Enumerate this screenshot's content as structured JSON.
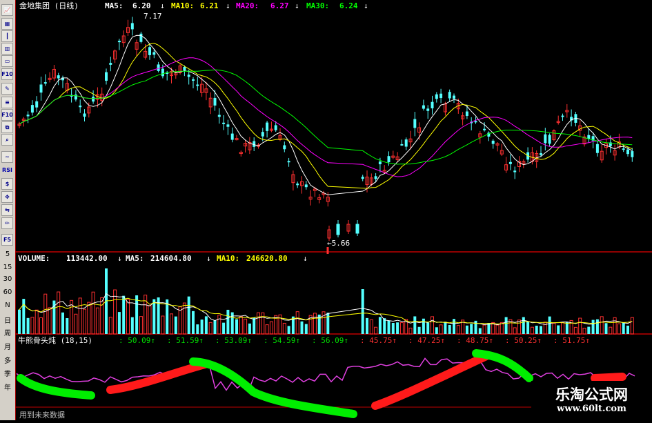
{
  "toolbar": {
    "buttons": [
      "line-chart",
      "table",
      "kline",
      "bar",
      "window",
      "F10",
      "note",
      "layers",
      "F10b",
      "compare",
      "search",
      "ta",
      "RSI",
      "dollar",
      "move",
      "switch",
      "pencil",
      "F5"
    ],
    "periods": [
      "5",
      "15",
      "30",
      "60",
      "N",
      "日",
      "周",
      "月",
      "多",
      "季",
      "年"
    ]
  },
  "header": {
    "stock": "金地集团 (日线)",
    "ma5_label": "MA5:",
    "ma5": "6.20",
    "ma10_label": "MA10:",
    "ma10": "6.21",
    "ma20_label": "MA20:",
    "ma20": "6.27",
    "ma30_label": "MA30:",
    "ma30": "6.24",
    "arrow": "↓"
  },
  "price_panel": {
    "high_label": "7.17",
    "low_label": "←5.66"
  },
  "volume_header": {
    "label": "VOLUME:",
    "value": "113442.00",
    "ma5_label": "MA5:",
    "ma5": "214604.80",
    "ma10_label": "MA10:",
    "ma10": "246620.80",
    "arrow": "↓"
  },
  "indicator_header": {
    "name": "牛熊骨头炖 (18,15)",
    "values": [
      {
        "v": "50.09",
        "color": "#00dd00"
      },
      {
        "v": "51.59",
        "color": "#00dd00"
      },
      {
        "v": "53.09",
        "color": "#00dd00"
      },
      {
        "v": "54.59",
        "color": "#00dd00"
      },
      {
        "v": "56.09",
        "color": "#00dd00"
      },
      {
        "v": "45.75",
        "color": "#ff3030"
      },
      {
        "v": "47.25",
        "color": "#ff3030"
      },
      {
        "v": "48.75",
        "color": "#ff3030"
      },
      {
        "v": "50.25",
        "color": "#ff3030"
      },
      {
        "v": "51.75",
        "color": "#ff3030"
      }
    ]
  },
  "footer": {
    "text": "用到未来数据"
  },
  "watermark": {
    "name": "乐淘公式网",
    "url": "www.60lt.com"
  },
  "chart_data": {
    "type": "candlestick",
    "panels": [
      "price",
      "volume",
      "indicator"
    ],
    "price_low_marker": 5.66,
    "price_high_marker": 7.17,
    "volume_ma5": 214604.8,
    "volume_ma10": 246620.8,
    "volume_last": 113442.0
  },
  "colors": {
    "up": "#ff3030",
    "down": "#54ffff",
    "ma5": "#ffffff",
    "ma10": "#ffff00",
    "ma20": "#ff00ff",
    "ma30": "#00ff00",
    "bull": "#00ee00",
    "bear": "#ff1a1a",
    "line": "#e040e0"
  }
}
